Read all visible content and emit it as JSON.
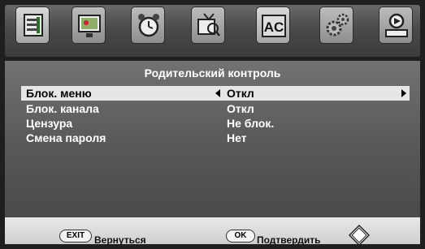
{
  "tabs": [
    {
      "icon": "picture-menu-icon",
      "active": true
    },
    {
      "icon": "display-settings-icon",
      "active": false
    },
    {
      "icon": "alarm-clock-icon",
      "active": false
    },
    {
      "icon": "channel-tv-icon",
      "active": false
    },
    {
      "icon": "language-ac-icon",
      "active": true
    },
    {
      "icon": "gears-settings-icon",
      "active": false
    },
    {
      "icon": "media-player-icon",
      "active": false
    }
  ],
  "menu": {
    "title": "Родительский контроль",
    "rows": [
      {
        "label": "Блок. меню",
        "value": "Откл",
        "selected": true
      },
      {
        "label": "Блок. канала",
        "value": "Откл",
        "selected": false
      },
      {
        "label": "Цензура",
        "value": "Не блок.",
        "selected": false
      },
      {
        "label": "Смена пароля",
        "value": "Нет",
        "selected": false
      }
    ]
  },
  "footer": {
    "exit_key": "EXIT",
    "exit_label": "Вернуться",
    "ok_key": "OK",
    "ok_label": "Подтвердить",
    "nav_icon": "diamond-navigation-icon"
  }
}
